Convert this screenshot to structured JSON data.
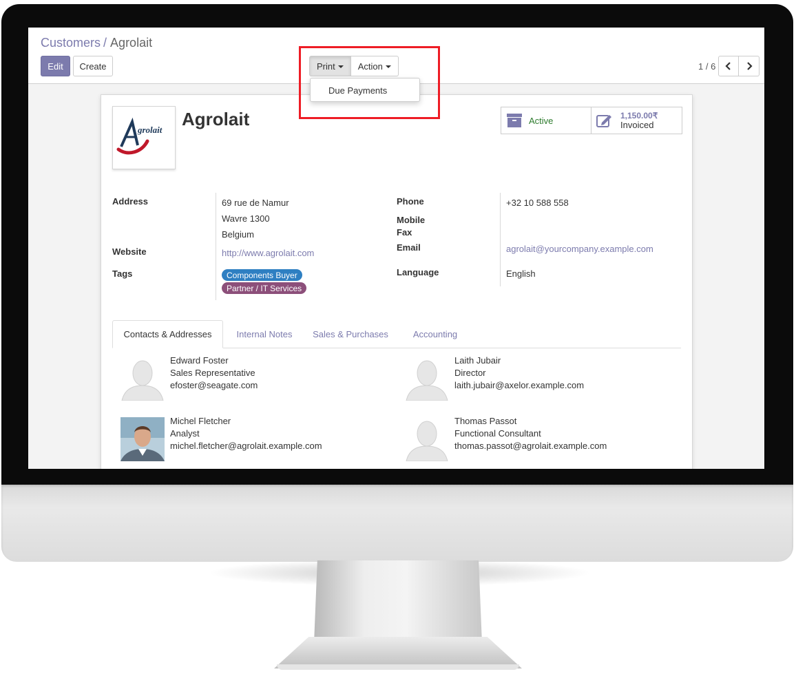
{
  "breadcrumb": {
    "parent": "Customers",
    "separator": "/",
    "current": "Agrolait"
  },
  "toolbar": {
    "edit_label": "Edit",
    "create_label": "Create",
    "print_label": "Print",
    "action_label": "Action"
  },
  "print_menu": {
    "items": [
      "Due Payments"
    ]
  },
  "pager": {
    "value": "1 / 6"
  },
  "partner": {
    "name": "Agrolait",
    "logo_text": "grolait"
  },
  "smart_buttons": {
    "active_label": "Active",
    "invoiced_amount": "1,150.00₹",
    "invoiced_label": "Invoiced"
  },
  "fields": {
    "address_label": "Address",
    "address_line1": "69 rue de Namur",
    "address_line2": "Wavre 1300",
    "address_line3": "Belgium",
    "website_label": "Website",
    "website_value": "http://www.agrolait.com",
    "tags_label": "Tags",
    "tags": [
      "Components Buyer",
      "Partner / IT Services"
    ],
    "phone_label": "Phone",
    "phone_value": "+32 10 588 558",
    "mobile_label": "Mobile",
    "fax_label": "Fax",
    "email_label": "Email",
    "email_value": "agrolait@yourcompany.example.com",
    "language_label": "Language",
    "language_value": "English"
  },
  "tabs": [
    "Contacts & Addresses",
    "Internal Notes",
    "Sales & Purchases",
    "Accounting"
  ],
  "contacts": [
    {
      "name": "Edward Foster",
      "role": "Sales Representative",
      "email": "efoster@seagate.com"
    },
    {
      "name": "Laith Jubair",
      "role": "Director",
      "email": "laith.jubair@axelor.example.com"
    },
    {
      "name": "Michel Fletcher",
      "role": "Analyst",
      "email": "michel.fletcher@agrolait.example.com"
    },
    {
      "name": "Thomas Passot",
      "role": "Functional Consultant",
      "email": "thomas.passot@agrolait.example.com"
    }
  ],
  "colors": {
    "brand": "#7c7bad",
    "highlight": "#ee1c25",
    "tag_components": "#2e7fc2",
    "tag_partner": "#8c4f7a",
    "active_green": "#2d7b2d"
  }
}
